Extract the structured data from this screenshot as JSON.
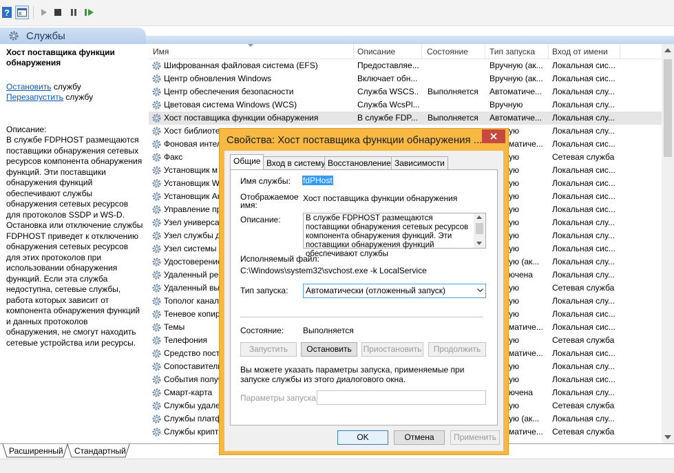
{
  "colors": {
    "selection": "#3399ff",
    "dialog_frame": "#f7b944",
    "close_button": "#c7483f",
    "link": "#0b56b8",
    "selected_row": "#e5e5e5"
  },
  "toolbar": {
    "icons": [
      "help-icon",
      "show-hide-pane-icon",
      "play-icon",
      "stop-icon",
      "pause-icon",
      "resume-icon"
    ]
  },
  "header": {
    "title": "Службы"
  },
  "left_panel": {
    "service_title": "Хост поставщика функции обнаружения",
    "stop_link": "Остановить",
    "stop_suffix": " службу",
    "restart_link": "Перезапустить",
    "restart_suffix": " службу",
    "description_label": "Описание:",
    "description": "В службе FDPHOST размещаются поставщики обнаружения сетевых ресурсов компонента обнаружения функций. Эти поставщики обнаружения функций обеспечивают службы обнаружения сетевых ресурсов для протоколов SSDP и WS-D. Остановка или отключение службы FDPHOST приведет к отключению обнаружения сетевых ресурсов для этих протоколов при использовании обнаружения функций. Если эта служба недоступна, сетевые службы, работа которых зависит от компонента обнаружения функций и данных протоколов обнаружения, не смогут находить сетевые устройства или ресурсы."
  },
  "list": {
    "columns": [
      "Имя",
      "Описание",
      "Состояние",
      "Тип запуска",
      "Вход от имени"
    ],
    "rows": [
      {
        "name": "Шифрованная файловая система (EFS)",
        "desc": "Предоставляе...",
        "state": "",
        "start": "Вручную (ак...",
        "logon": "Локальная сис..."
      },
      {
        "name": "Центр обновления Windows",
        "desc": "Включает обн...",
        "state": "",
        "start": "Вручную (ак...",
        "logon": "Локальная сис..."
      },
      {
        "name": "Центр обеспечения безопасности",
        "desc": "Служба WSCS...",
        "state": "Выполняется",
        "start": "Автоматиче...",
        "logon": "Локальная слу..."
      },
      {
        "name": "Цветовая система Windows (WCS)",
        "desc": "Служба WcsPl...",
        "state": "",
        "start": "Вручную",
        "logon": "Локальная слу..."
      },
      {
        "name": "Хост поставщика функции обнаружения",
        "desc": "В службе FDP...",
        "state": "Выполняется",
        "start": "Автоматиче...",
        "logon": "Локальная слу..."
      },
      {
        "name": "Хост библиоте",
        "desc": "",
        "state": "",
        "start": "ую",
        "logon": "Локальная слу..."
      },
      {
        "name": "Фоновая интел",
        "desc": "",
        "state": "",
        "start": "матиче...",
        "logon": "Локальная сис..."
      },
      {
        "name": "Факс",
        "desc": "",
        "state": "",
        "start": "ую",
        "logon": "Сетевая служба"
      },
      {
        "name": "Установщик м",
        "desc": "",
        "state": "",
        "start": "ую",
        "logon": "Локальная сис..."
      },
      {
        "name": "Установщик W",
        "desc": "",
        "state": "",
        "start": "ую",
        "logon": "Локальная сис..."
      },
      {
        "name": "Установщик Ак",
        "desc": "",
        "state": "",
        "start": "ую",
        "logon": "Локальная сис..."
      },
      {
        "name": "Управление пр",
        "desc": "",
        "state": "",
        "start": "ую",
        "logon": "Локальная сис..."
      },
      {
        "name": "Узел универсал",
        "desc": "",
        "state": "",
        "start": "ую",
        "logon": "Локальная слу..."
      },
      {
        "name": "Узел службы д",
        "desc": "",
        "state": "",
        "start": "ую",
        "logon": "Локальная слу..."
      },
      {
        "name": "Узел системы д",
        "desc": "",
        "state": "",
        "start": "ую",
        "logon": "Локальная сис..."
      },
      {
        "name": "Удостоверение",
        "desc": "",
        "state": "",
        "start": "ую (ак...",
        "logon": "Локальная слу..."
      },
      {
        "name": "Удаленный рее",
        "desc": "",
        "state": "",
        "start": "ючена",
        "logon": "Локальная слу..."
      },
      {
        "name": "Удаленный вы",
        "desc": "",
        "state": "",
        "start": "ую",
        "logon": "Сетевая служба"
      },
      {
        "name": "Тополог канал",
        "desc": "",
        "state": "",
        "start": "ую",
        "logon": "Локальная слу..."
      },
      {
        "name": "Теневое копир",
        "desc": "",
        "state": "",
        "start": "ую",
        "logon": "Локальная сис..."
      },
      {
        "name": "Темы",
        "desc": "",
        "state": "",
        "start": "матиче...",
        "logon": "Локальная сис..."
      },
      {
        "name": "Телефония",
        "desc": "",
        "state": "",
        "start": "ую",
        "logon": "Сетевая служба"
      },
      {
        "name": "Средство постр",
        "desc": "",
        "state": "",
        "start": "матиче...",
        "logon": "Локальная сис..."
      },
      {
        "name": "Сопоставитель",
        "desc": "",
        "state": "",
        "start": "ую",
        "logon": "Локальная слу..."
      },
      {
        "name": "События получ",
        "desc": "",
        "state": "",
        "start": "ую",
        "logon": "Локальная сис..."
      },
      {
        "name": "Смарт-карта",
        "desc": "",
        "state": "",
        "start": "ючена",
        "logon": "Локальная слу..."
      },
      {
        "name": "Службы удале",
        "desc": "",
        "state": "",
        "start": "ую",
        "logon": "Сетевая служба"
      },
      {
        "name": "Службы платф",
        "desc": "",
        "state": "",
        "start": "ую (ак...",
        "logon": "Локальная слу..."
      },
      {
        "name": "Службы крипт",
        "desc": "",
        "state": "",
        "start": "матиче...",
        "logon": "Сетевая служба"
      }
    ]
  },
  "bottom_tabs": [
    "Расширенный",
    "Стандартный"
  ],
  "dialog": {
    "title": "Свойства: Хост поставщика функции обнаружения ...",
    "tabs": [
      "Общие",
      "Вход в систему",
      "Восстановление",
      "Зависимости"
    ],
    "service_name_label": "Имя службы:",
    "service_name": "fdPHost",
    "display_name_label_1": "Отображаемое",
    "display_name_label_2": "имя:",
    "display_name": "Хост поставщика функции обнаружения",
    "description_label": "Описание:",
    "description": "В службе FDPHOST размещаются поставщики обнаружения сетевых ресурсов компонента обнаружения функций. Эти поставщики обнаружения функций обеспечивают службы",
    "exe_label": "Исполняемый файл:",
    "exe_path": "C:\\Windows\\system32\\svchost.exe -k LocalService",
    "startup_label": "Тип запуска:",
    "startup_value": "Автоматически (отложенный запуск)",
    "state_label": "Состояние:",
    "state_value": "Выполняется",
    "start_btn": "Запустить",
    "stop_btn": "Остановить",
    "pause_btn": "Приостановить",
    "resume_btn": "Продолжить",
    "hint": "Вы можете указать параметры запуска, применяемые при запуске службы из этого диалогового окна.",
    "params_label": "Параметры запуска:",
    "params_value": "",
    "ok": "OK",
    "cancel": "Отмена",
    "apply": "Применить"
  }
}
